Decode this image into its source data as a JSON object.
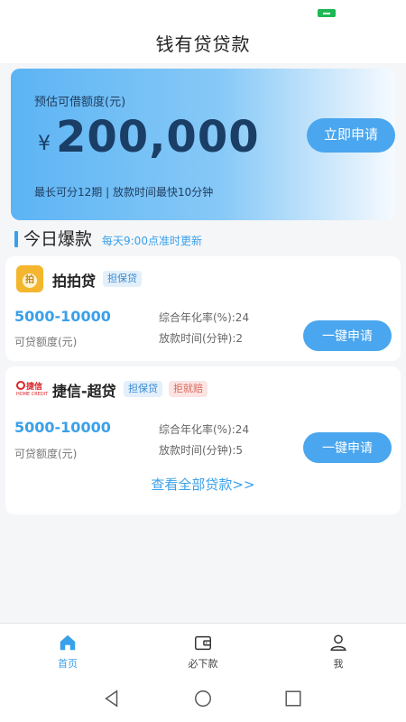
{
  "header": {
    "title": "钱有贷贷款"
  },
  "hero": {
    "label": "预估可借额度(元)",
    "currency": "¥",
    "amount": "200,000",
    "note": "最长可分12期   |   放款时间最快10分钟",
    "apply_label": "立即申请"
  },
  "section": {
    "title": "今日爆款",
    "subtitle": "每天9:00点准时更新"
  },
  "products": [
    {
      "name": "拍拍贷",
      "logo_icon": "paipaidai-logo-icon",
      "tags": [
        "担保贷"
      ],
      "range": "5000-10000",
      "range_label": "可贷额度(元)",
      "rate": "综合年化率(%):24",
      "time": "放款时间(分钟):2",
      "apply_label": "一键申请"
    },
    {
      "name": "捷信-超贷",
      "logo_icon": "homecredit-logo-icon",
      "logo_text": "捷信",
      "logo_subtext": "HOME CREDIT",
      "tags": [
        "担保贷",
        "拒就赔"
      ],
      "range": "5000-10000",
      "range_label": "可贷额度(元)",
      "rate": "综合年化率(%):24",
      "time": "放款时间(分钟):5",
      "apply_label": "一键申请"
    }
  ],
  "view_all": "查看全部贷款>>",
  "tabs": [
    {
      "label": "首页",
      "icon": "home-icon",
      "active": true
    },
    {
      "label": "必下款",
      "icon": "wallet-icon",
      "active": false
    },
    {
      "label": "我",
      "icon": "user-icon",
      "active": false
    }
  ],
  "colors": {
    "accent": "#3aa0ea",
    "button": "#4aa6ee",
    "amount": "#1a3e66",
    "tag_red": "#d76a5f"
  }
}
